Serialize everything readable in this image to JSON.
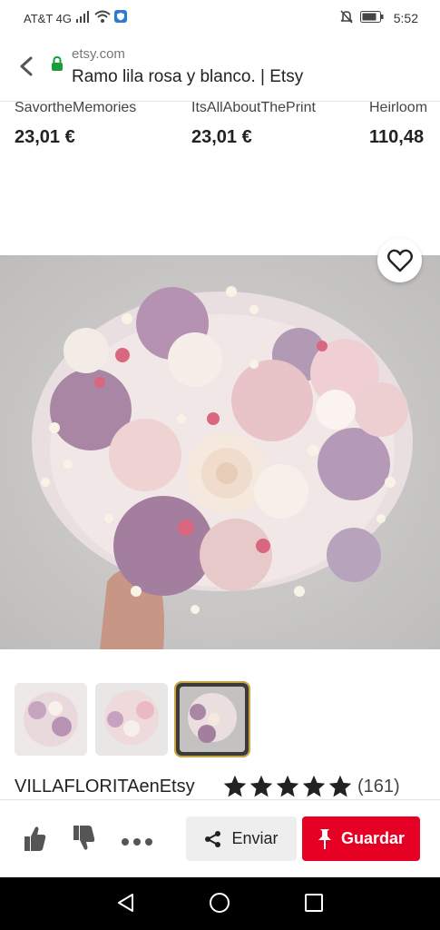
{
  "status_bar": {
    "carrier": "AT&T 4G",
    "time": "5:52"
  },
  "browser": {
    "domain": "etsy.com",
    "title": "Ramo lila rosa y blanco. | Etsy"
  },
  "related_products": [
    {
      "shop": "SavortheMemories",
      "price": "23,01 €"
    },
    {
      "shop": "ItsAllAboutThePrint",
      "price": "23,01 €"
    },
    {
      "shop": "Heirloom",
      "price": "110,48"
    }
  ],
  "product": {
    "seller": "VILLAFLORITAenEtsy",
    "rating": 5,
    "reviews": "(161)",
    "thumbnails": 3,
    "active_thumbnail": 3
  },
  "actions": {
    "share_label": "Enviar",
    "save_label": "Guardar"
  },
  "colors": {
    "save_button": "#e60023",
    "active_thumb_border": "#c9a441"
  }
}
